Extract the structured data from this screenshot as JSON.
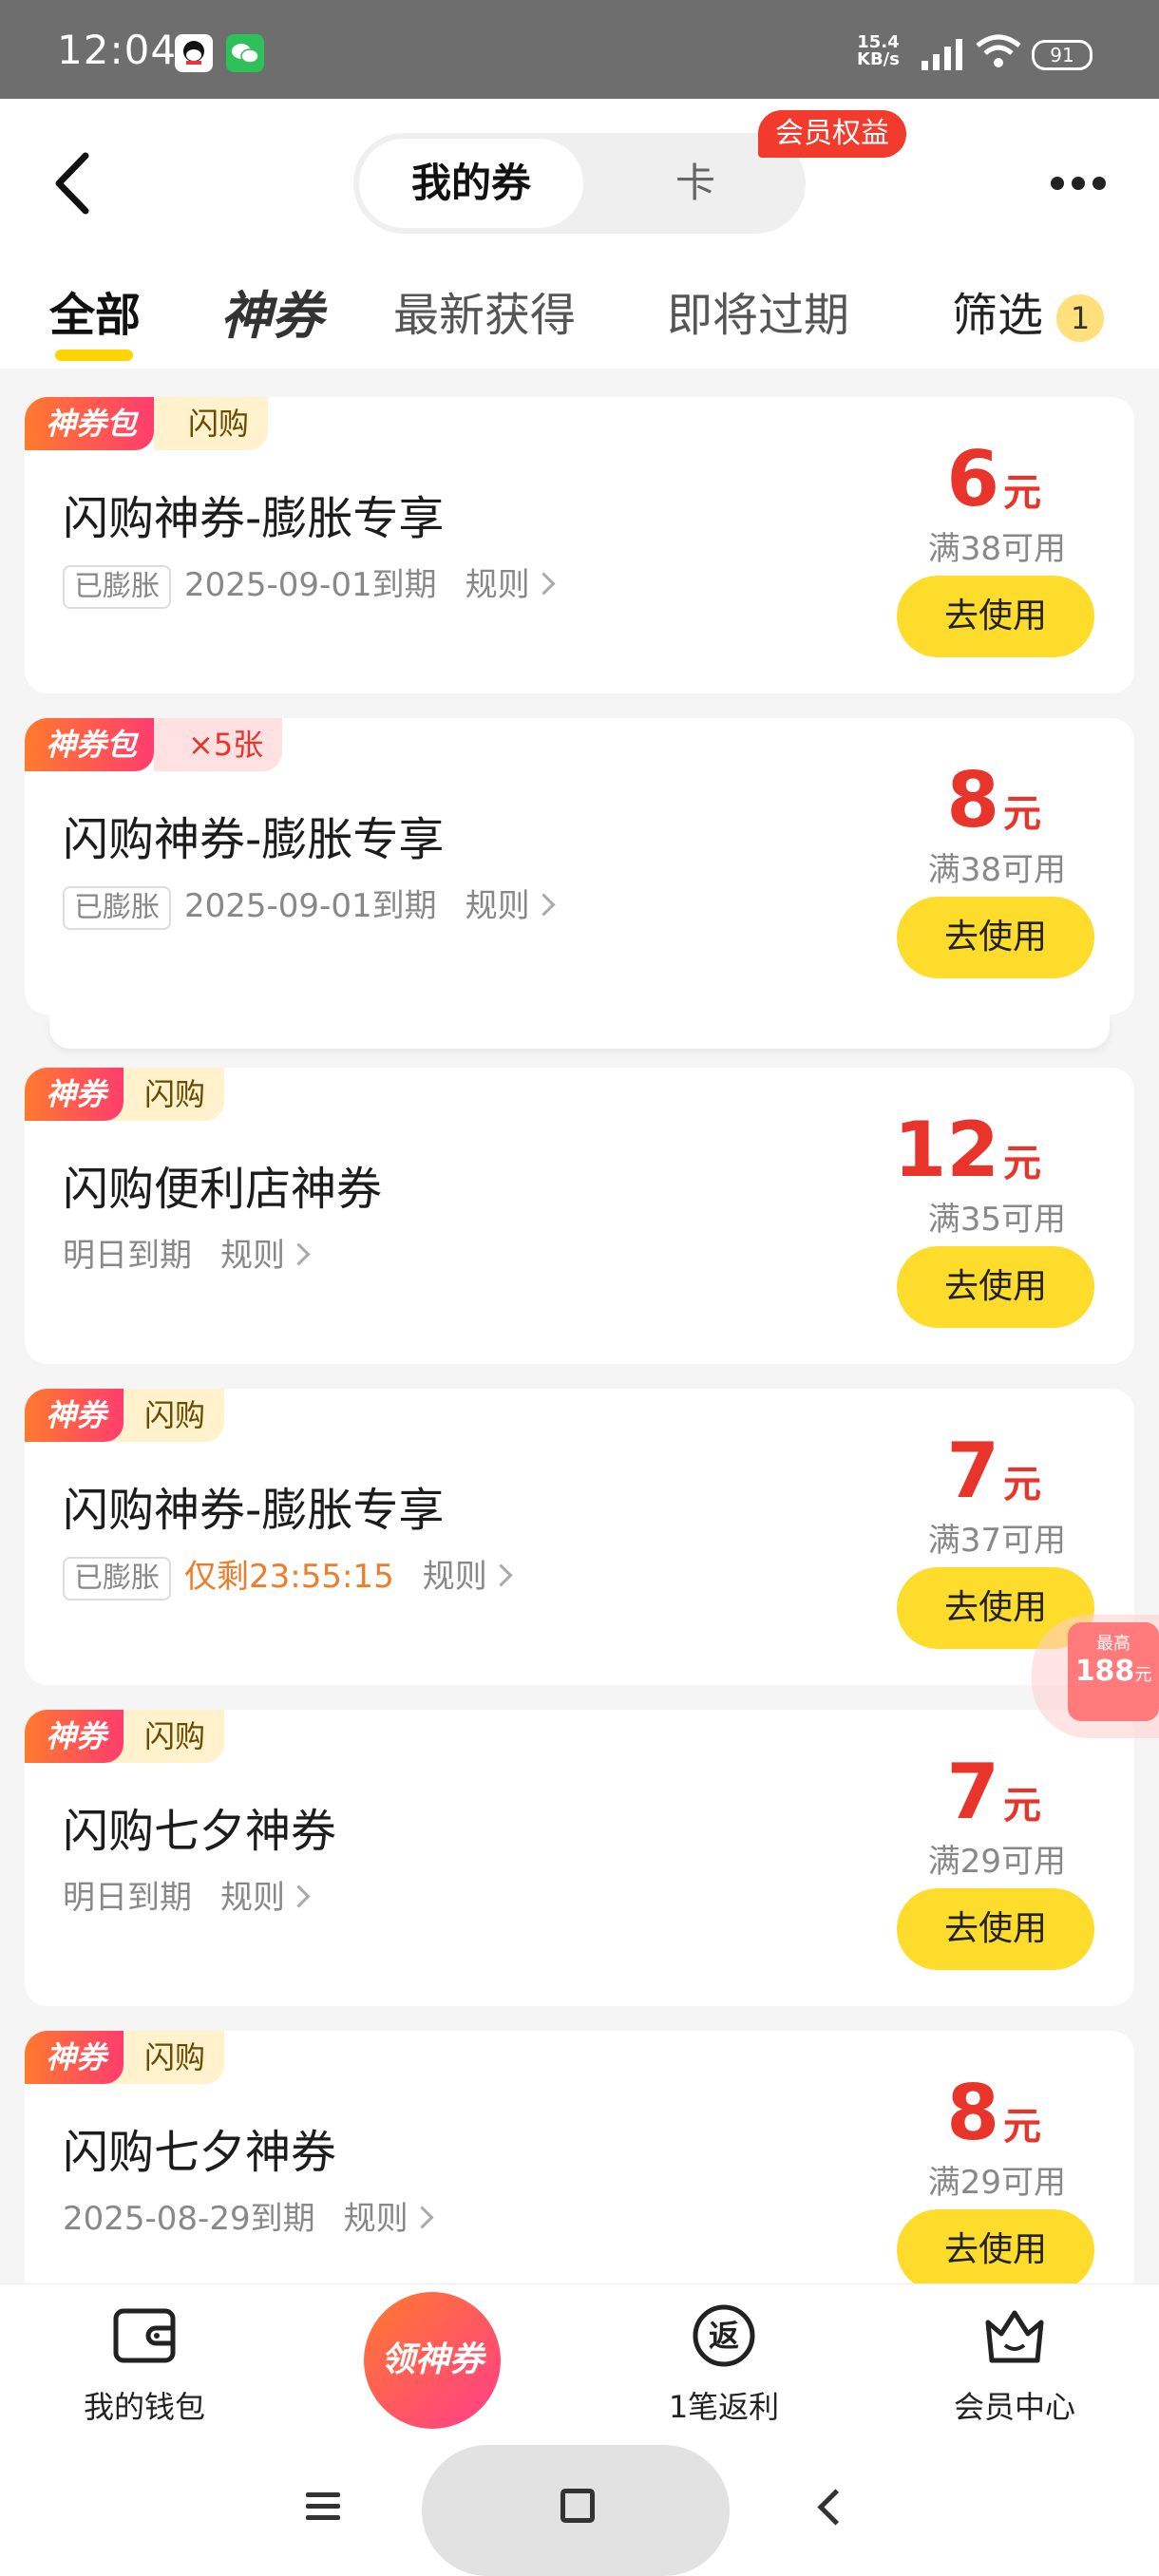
{
  "status_bar": {
    "time": "12:04",
    "net_speed_value": "15.4",
    "net_speed_unit": "KB/s",
    "battery": "91",
    "apps": [
      "qq-icon",
      "wechat-icon"
    ]
  },
  "header": {
    "tab_active": "我的券",
    "tab_inactive": "卡",
    "member_badge": "会员权益"
  },
  "filters": {
    "items": [
      "全部",
      "神券",
      "最新获得",
      "即将过期",
      "筛选"
    ],
    "count": "1"
  },
  "coupons": [
    {
      "tag1": "神券包",
      "tag2": "闪购",
      "title": "闪购神券-膨胀专享",
      "badge": "已膨胀",
      "expiry": "2025-09-01到期",
      "rule": "规则",
      "amount": "6",
      "unit": "元",
      "condition": "满38可用",
      "button": "去使用"
    },
    {
      "tag1": "神券包",
      "tag2": "×5张",
      "title": "闪购神券-膨胀专享",
      "badge": "已膨胀",
      "expiry": "2025-09-01到期",
      "rule": "规则",
      "amount": "8",
      "unit": "元",
      "condition": "满38可用",
      "button": "去使用"
    },
    {
      "tag1": "神券",
      "tag2": "闪购",
      "title": "闪购便利店神券",
      "badge": "",
      "expiry": "明日到期",
      "rule": "规则",
      "amount": "12",
      "unit": "元",
      "condition": "满35可用",
      "button": "去使用"
    },
    {
      "tag1": "神券",
      "tag2": "闪购",
      "title": "闪购神券-膨胀专享",
      "badge": "已膨胀",
      "expiry": "仅剩23:55:15",
      "rule": "规则",
      "amount": "7",
      "unit": "元",
      "condition": "满37可用",
      "button": "去使用"
    },
    {
      "tag1": "神券",
      "tag2": "闪购",
      "title": "闪购七夕神券",
      "badge": "",
      "expiry": "明日到期",
      "rule": "规则",
      "amount": "7",
      "unit": "元",
      "condition": "满29可用",
      "button": "去使用"
    },
    {
      "tag1": "神券",
      "tag2": "闪购",
      "title": "闪购七夕神券",
      "badge": "",
      "expiry": "2025-08-29到期",
      "rule": "规则",
      "amount": "8",
      "unit": "元",
      "condition": "满29可用",
      "button": "去使用"
    }
  ],
  "float_widget": {
    "top": "最高",
    "amount": "188",
    "unit": "元"
  },
  "bottom_nav": {
    "wallet": "我的钱包",
    "center": "领神券",
    "rebate": "1笔返利",
    "rebate_icon_char": "返",
    "member": "会员中心"
  },
  "colors": {
    "accent_yellow": "#fedc2c",
    "price_red": "#e8342b",
    "urgent_orange": "#ee7d2a"
  }
}
